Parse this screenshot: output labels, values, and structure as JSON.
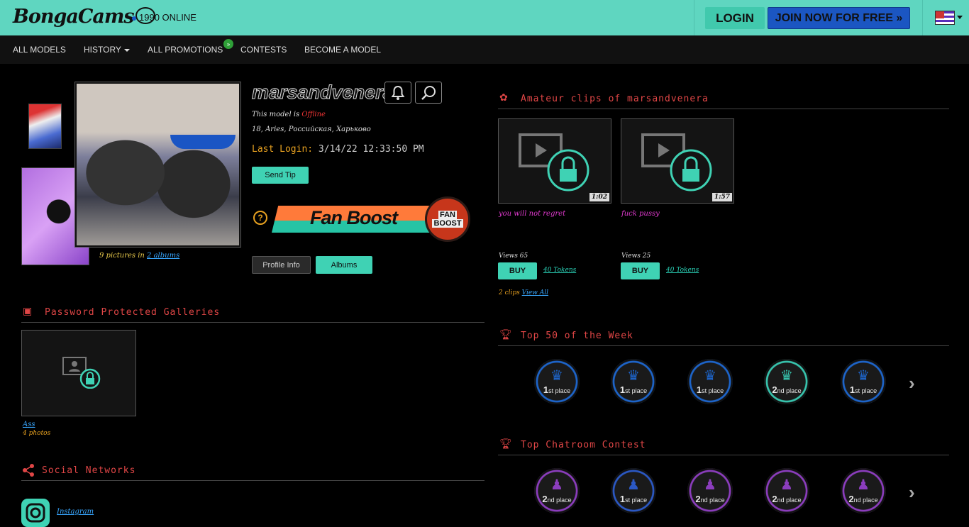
{
  "header": {
    "logo_text": "BongaCams",
    "online_text": "1990 ONLINE",
    "login_label": "LOGIN",
    "join_label": "JOIN NOW FOR FREE »"
  },
  "nav": {
    "items": [
      "ALL MODELS",
      "HISTORY",
      "ALL PROMOTIONS",
      "CONTESTS",
      "BECOME A MODEL"
    ],
    "promotions_badge": "»"
  },
  "profile": {
    "username": "marsandvenera",
    "status_prefix": "This model is",
    "status_value": "Offline",
    "details": "18, Aries, Российская, Харьково",
    "last_login_label": "Last Login:",
    "last_login_value": "3/14/22 12:33:50 PM",
    "send_tip_label": "Send Tip",
    "fanboost_label": "Fan Boost",
    "fanboost_seal_top": "FAN",
    "fanboost_seal_bottom": "BOOST",
    "help_icon": "?",
    "pics_count_prefix": "9 pictures in",
    "pics_count_link": "2 albums",
    "profile_info_label": "Profile Info",
    "albums_label": "Albums"
  },
  "galleries": {
    "title": "Password Protected Galleries",
    "items": [
      {
        "name": "Ass",
        "count": "4 photos"
      }
    ]
  },
  "social": {
    "title": "Social Networks",
    "instagram_label": "Instagram"
  },
  "clips": {
    "title": "Amateur clips of marsandvenera",
    "items": [
      {
        "duration": "1:02",
        "title": "you will not regret",
        "views": "Views 65",
        "buy_label": "BUY",
        "price": "40 Tokens"
      },
      {
        "duration": "1:57",
        "title": "fuck pussy",
        "views": "Views 25",
        "buy_label": "BUY",
        "price": "40 Tokens"
      }
    ],
    "count_prefix": "2 clips",
    "count_link": "View All"
  },
  "top50": {
    "title": "Top 50 of the Week",
    "medals": [
      {
        "num": "1",
        "suffix": "st place",
        "color": "#1d64c9"
      },
      {
        "num": "1",
        "suffix": "st place",
        "color": "#1d64c9"
      },
      {
        "num": "1",
        "suffix": "st place",
        "color": "#1d64c9"
      },
      {
        "num": "2",
        "suffix": "nd place",
        "color": "#37c3ad"
      },
      {
        "num": "1",
        "suffix": "st place",
        "color": "#1d64c9"
      }
    ]
  },
  "chatroom_contest": {
    "title": "Top Chatroom Contest",
    "medals": [
      {
        "num": "2",
        "suffix": "nd place",
        "color": "#8b3dbd"
      },
      {
        "num": "1",
        "suffix": "st place",
        "color": "#2b58c4"
      },
      {
        "num": "2",
        "suffix": "nd place",
        "color": "#8b3dbd"
      },
      {
        "num": "2",
        "suffix": "nd place",
        "color": "#8b3dbd"
      },
      {
        "num": "2",
        "suffix": "nd place",
        "color": "#8b3dbd"
      }
    ]
  }
}
